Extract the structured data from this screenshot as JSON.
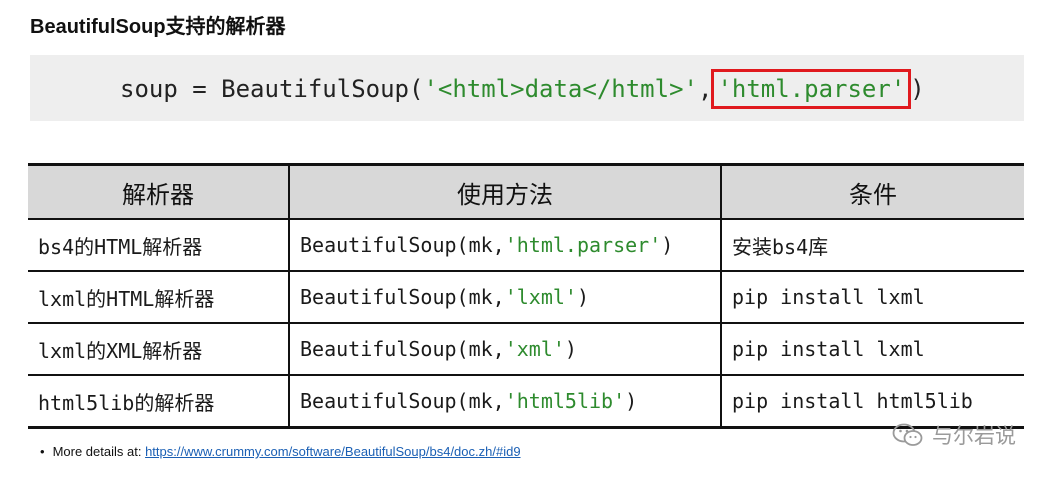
{
  "title": "BeautifulSoup支持的解析器",
  "code": {
    "pre": "soup = BeautifulSoup(",
    "arg1": "'<html>data</html>'",
    "sep": ",",
    "arg2": "'html.parser'",
    "post": ")"
  },
  "table": {
    "headers": [
      "解析器",
      "使用方法",
      "条件"
    ],
    "rows": [
      {
        "parser": "bs4的HTML解析器",
        "usage_pre": "BeautifulSoup(mk,",
        "usage_arg": "'html.parser'",
        "usage_post": ")",
        "condition": "安装bs4库"
      },
      {
        "parser": "lxml的HTML解析器",
        "usage_pre": "BeautifulSoup(mk,",
        "usage_arg": "'lxml'",
        "usage_post": ")",
        "condition": "pip install lxml"
      },
      {
        "parser": "lxml的XML解析器",
        "usage_pre": "BeautifulSoup(mk,",
        "usage_arg": "'xml'",
        "usage_post": ")",
        "condition": "pip install lxml"
      },
      {
        "parser": "html5lib的解析器",
        "usage_pre": "BeautifulSoup(mk,",
        "usage_arg": "'html5lib'",
        "usage_post": ")",
        "condition": "pip install html5lib"
      }
    ]
  },
  "note": {
    "label": "More details at:",
    "link": "https://www.crummy.com/software/BeautifulSoup/bs4/doc.zh/#id9"
  },
  "watermark": {
    "text": "与尔岩说",
    "icon": "wechat-icon"
  },
  "colors": {
    "string_green": "#2e8b2e",
    "highlight_red": "#e0191e",
    "link_blue": "#1a5fb4",
    "code_bg": "#eeeeee",
    "header_bg": "#d8d8d8"
  }
}
